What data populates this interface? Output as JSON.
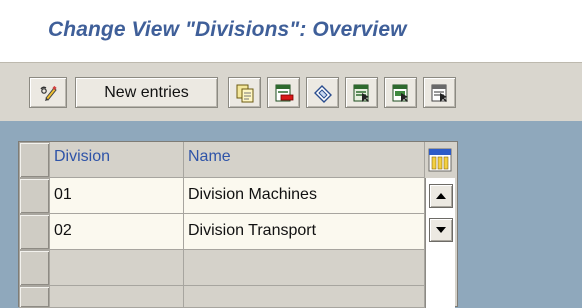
{
  "screen": {
    "title": "Change View \"Divisions\": Overview"
  },
  "toolbar": {
    "buttons": [
      {
        "id": "display-change",
        "icon": "pencil-glasses-icon"
      },
      {
        "id": "new-entries",
        "label": "New entries"
      },
      {
        "id": "copy",
        "icon": "copy-icon"
      },
      {
        "id": "delete",
        "icon": "delete-icon"
      },
      {
        "id": "undo-change",
        "icon": "undo-change-icon"
      },
      {
        "id": "select-all",
        "icon": "select-all-icon"
      },
      {
        "id": "select-block",
        "icon": "select-block-icon"
      },
      {
        "id": "deselect-all",
        "icon": "deselect-all-icon"
      }
    ]
  },
  "table": {
    "columns": [
      "Division",
      "Name"
    ],
    "rows": [
      {
        "division": "01",
        "name": "Division Machines"
      },
      {
        "division": "02",
        "name": "Division Transport"
      },
      {
        "division": "",
        "name": ""
      },
      {
        "division": "",
        "name": ""
      }
    ],
    "icons": {
      "column_settings": "table-settings-icon",
      "scroll_up": "scroll-up-arrow-icon",
      "scroll_down": "scroll-down-arrow-icon"
    }
  },
  "colors": {
    "title": "#3f5f99",
    "header_text": "#2f54a8",
    "background": "#8fa8bc",
    "toolbar": "#d9d6ce",
    "row_input": "#fbf9ef"
  }
}
